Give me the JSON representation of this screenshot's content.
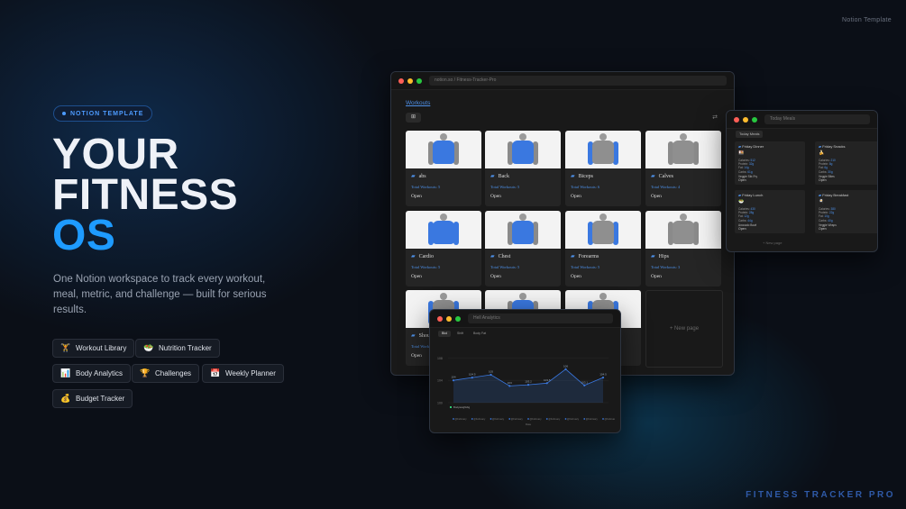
{
  "corner_tag": "Notion Template",
  "bottom_brand": "FITNESS TRACKER PRO",
  "badge": "NOTION TEMPLATE",
  "hero": {
    "line1": "YOUR",
    "line2": "FITNESS",
    "line3": "OS"
  },
  "subtitle": "One Notion workspace to track every workout, meal, metric, and challenge — built for serious results.",
  "features": [
    {
      "icon": "dumbbell-icon",
      "glyph": "🏋",
      "label": "Workout Library"
    },
    {
      "icon": "salad-bowl-icon",
      "glyph": "🥗",
      "label": "Nutrition Tracker"
    },
    {
      "icon": "bar-chart-icon",
      "glyph": "📊",
      "label": "Body Analytics"
    },
    {
      "icon": "trophy-icon",
      "glyph": "🏆",
      "label": "Challenges"
    },
    {
      "icon": "calendar-icon",
      "glyph": "📅",
      "label": "Weekly Planner"
    },
    {
      "icon": "money-bag-icon",
      "glyph": "💰",
      "label": "Budget Tracker"
    }
  ],
  "workouts_window": {
    "url": "notion.so / Fitness-Tracker-Pro",
    "title": "Workouts",
    "cards": [
      {
        "name": "abs",
        "meta": "Total Workouts: 5",
        "open": "Open",
        "focus": "torso"
      },
      {
        "name": "Back",
        "meta": "Total Workouts: 5",
        "open": "Open",
        "focus": "torso"
      },
      {
        "name": "Biceps",
        "meta": "Total Workouts: 6",
        "open": "Open",
        "focus": "arms"
      },
      {
        "name": "Calves",
        "meta": "Total Workouts: 4",
        "open": "Open",
        "focus": "legs"
      },
      {
        "name": "Cardio",
        "meta": "Total Workouts: 5",
        "open": "Open",
        "focus": "all"
      },
      {
        "name": "Chest",
        "meta": "Total Workouts: 5",
        "open": "Open",
        "focus": "torso"
      },
      {
        "name": "Forearms",
        "meta": "Total Workouts: 5",
        "open": "Open",
        "focus": "arms"
      },
      {
        "name": "Hips",
        "meta": "Total Workouts: 3",
        "open": "Open",
        "focus": "hips"
      },
      {
        "name": "Shoulders",
        "meta": "Total Workouts: 5",
        "open": "Open",
        "focus": "arms"
      },
      {
        "name": "",
        "meta": "",
        "open": "",
        "focus": "back"
      },
      {
        "name": "",
        "meta": "",
        "open": "",
        "focus": "arms"
      }
    ],
    "new_page": "+ New page"
  },
  "day_window": {
    "title": "Today Meals",
    "button": "Today Meals",
    "meals": [
      {
        "title": "Friday Dinner",
        "icon": "🍱",
        "rows": [
          [
            "Calories:",
            "512"
          ],
          [
            "Protein:",
            "32g"
          ],
          [
            "Fat:",
            "14g"
          ],
          [
            "Carbs:",
            "61g"
          ]
        ],
        "note": "Veggie Stir-Fry",
        "open": "Open"
      },
      {
        "title": "Friday Snacks",
        "icon": "🍌",
        "rows": [
          [
            "Calories:",
            "210"
          ],
          [
            "Protein:",
            "8g"
          ],
          [
            "Fat:",
            "6g"
          ],
          [
            "Carbs:",
            "30g"
          ]
        ],
        "note": "Veggie Bites",
        "open": "Open"
      },
      {
        "title": "Friday Lunch",
        "icon": "🥗",
        "rows": [
          [
            "Calories:",
            "430"
          ],
          [
            "Protein:",
            "28g"
          ],
          [
            "Fat:",
            "12g"
          ],
          [
            "Carbs:",
            "44g"
          ]
        ],
        "note": "Avocado Bowl",
        "open": "Open"
      },
      {
        "title": "Friday Breakfast",
        "icon": "🍳",
        "rows": [
          [
            "Calories:",
            "380"
          ],
          [
            "Protein:",
            "22g"
          ],
          [
            "Fat:",
            "10g"
          ],
          [
            "Carbs:",
            "40g"
          ]
        ],
        "note": "Veggie Wraps",
        "open": "Open"
      }
    ],
    "new_page": "+ New page"
  },
  "analytics_window": {
    "title": "Hell Analytics",
    "tabs": [
      "Bkd",
      "Shift",
      "Body Fat"
    ],
    "chart_data": {
      "type": "area",
      "title": "",
      "ylabel": "",
      "xlabel": "Date",
      "series": [
        {
          "name": "Bodyweight/kg",
          "values": [
            104,
            104.5,
            105,
            103,
            103.2,
            103.5,
            106,
            103.1,
            104.5
          ]
        }
      ],
      "x": [
        "@February",
        "@February",
        "@February",
        "@February",
        "@February",
        "@February",
        "@February",
        "@February",
        "@February"
      ],
      "yticks": [
        "100",
        "104",
        "108"
      ],
      "ylim": [
        100,
        110
      ],
      "accent": "#3a78e0"
    }
  },
  "colors": {
    "accent": "#1e9bff",
    "link": "#4d8fe6",
    "highlight": "#3a78e0"
  }
}
